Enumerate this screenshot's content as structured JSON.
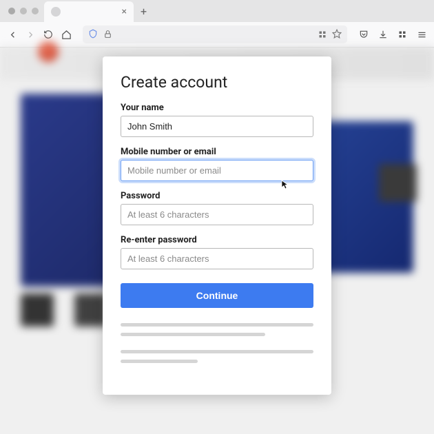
{
  "modal": {
    "title": "Create account",
    "name": {
      "label": "Your name",
      "value": "John Smith"
    },
    "mobile_email": {
      "label": "Mobile number or email",
      "placeholder": "Mobile number or email"
    },
    "password": {
      "label": "Password",
      "placeholder": "At least 6 characters"
    },
    "reenter": {
      "label": "Re-enter password",
      "placeholder": "At least 6 characters"
    },
    "continue_label": "Continue"
  },
  "colors": {
    "accent": "#3d7bf0",
    "focus_ring": "#6b9ef3"
  }
}
